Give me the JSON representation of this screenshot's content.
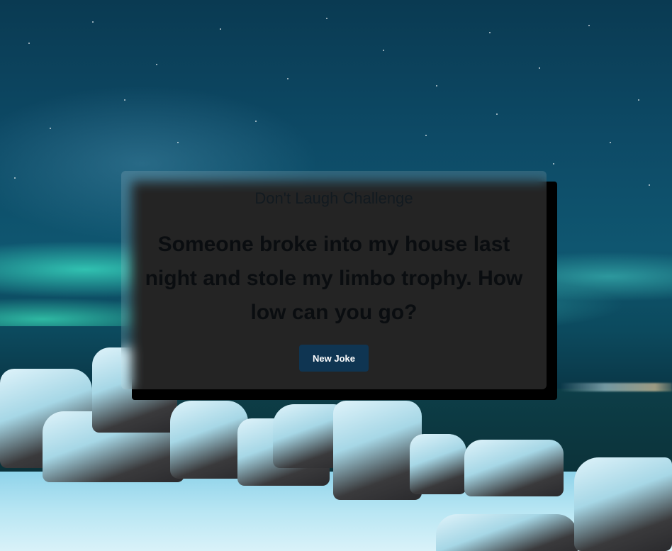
{
  "card": {
    "title": "Don't Laugh Challenge",
    "joke": "Someone broke into my house last night and stole my limbo trophy. How low can you go?",
    "button_label": "New Joke"
  },
  "colors": {
    "button_bg": "#0f3552",
    "button_text": "#ffffff",
    "card_shadow": "#000000",
    "background_sky": "#0d4a66",
    "aurora": "#3ce6c8"
  }
}
